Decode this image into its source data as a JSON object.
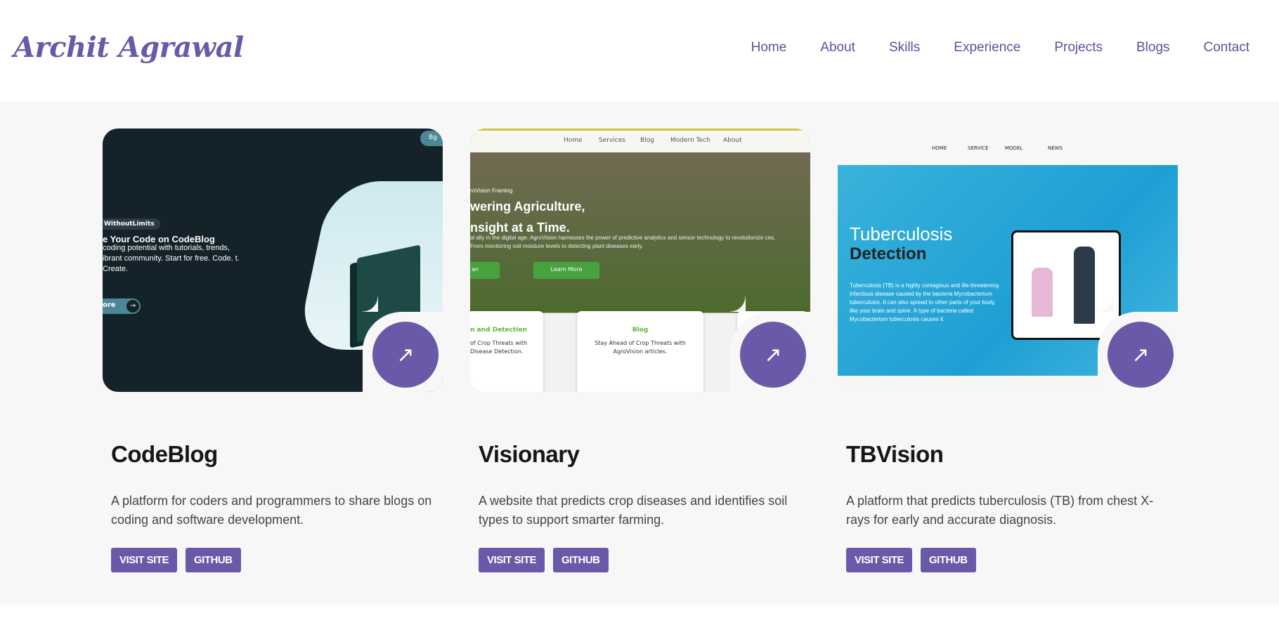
{
  "header": {
    "logo": "Archit Agrawal",
    "nav": [
      "Home",
      "About",
      "Skills",
      "Experience",
      "Projects",
      "Blogs",
      "Contact"
    ]
  },
  "projects": [
    {
      "title": "CodeBlog",
      "description": "A platform for coders and programmers to share blogs on coding and software development.",
      "visit_label": "VISIT SITE",
      "github_label": "GITHUB",
      "preview": {
        "tag": "Bg",
        "badge": "WithoutLimits",
        "heading": "e Your Code on CodeBlog",
        "text": "coding potential with tutorials, trends, ibrant community. Start for free. Code. t. Create.",
        "more": "ore"
      }
    },
    {
      "title": "Visionary",
      "description": "A website that predicts crop diseases and identifies soil types to support smarter farming.",
      "visit_label": "VISIT SITE",
      "github_label": "GITHUB",
      "preview": {
        "nav": [
          "Home",
          "Services",
          "Blog",
          "Modern Tech",
          "About"
        ],
        "label": "roVision Framing",
        "heading1": "wering Agriculture,",
        "heading2": "nsight at a Time.",
        "text": "al ally in the digital age. AgroVision harnesses the power of predictive analytics and sensor technology to revolutionize ces. From monitoring soil moisture levels to detecting plant diseases early.",
        "button1": "an",
        "button2": "Learn More",
        "card1_title": "n and Detection",
        "card1_text": "of Crop Threats with Disease Detection.",
        "card2_title": "Blog",
        "card2_text": "Stay Ahead of Crop Threats with AgroVision articles."
      }
    },
    {
      "title": "TBVision",
      "description": "A platform that predicts tuberculosis (TB) from chest X-rays for early and accurate diagnosis.",
      "visit_label": "VISIT SITE",
      "github_label": "GITHUB",
      "preview": {
        "nav": [
          "HOME",
          "SERVICE",
          "MODEL",
          "NEWS"
        ],
        "heading1": "Tuberculosis",
        "heading2": "Detection",
        "text": "Tuberculosis (TB) is a highly contagious and life-threatening infectious disease caused by the bacteria Mycobacterium tuberculosis. It can also spread to other parts of your body, like your brain and spine. A type of bacteria called Mycobacterium tuberculosis causes it."
      }
    }
  ],
  "arrow_symbol": "↗"
}
